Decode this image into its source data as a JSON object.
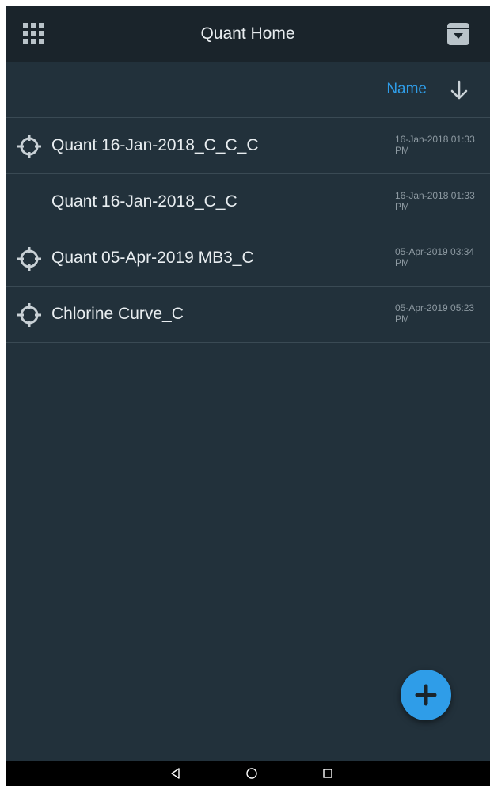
{
  "app": {
    "title": "Quant Home"
  },
  "header": {
    "left_icon": "apps-grid-icon",
    "right_icon": "archive-download-icon"
  },
  "sort": {
    "label": "Name",
    "direction_icon": "arrow-down-icon"
  },
  "items": [
    {
      "name": "Quant 16-Jan-2018_C_C_C",
      "date_line1": "16-Jan-2018 01:33",
      "date_line2": "PM",
      "icon": "target-icon"
    },
    {
      "name": "Quant 16-Jan-2018_C_C",
      "date_line1": "16-Jan-2018 01:33",
      "date_line2": "PM",
      "icon": ""
    },
    {
      "name": "Quant 05-Apr-2019 MB3_C",
      "date_line1": "05-Apr-2019 03:34",
      "date_line2": "PM",
      "icon": "target-icon"
    },
    {
      "name": "Chlorine Curve_C",
      "date_line1": "05-Apr-2019 05:23",
      "date_line2": "PM",
      "icon": "target-icon"
    }
  ],
  "fab": {
    "icon": "plus-icon"
  },
  "system_nav": {
    "back_icon": "back-triangle-icon",
    "home_icon": "home-circle-icon",
    "recents_icon": "recents-square-icon"
  },
  "colors": {
    "background": "#22313b",
    "appbar": "#1a242b",
    "accent": "#2f9de8",
    "text": "#e8edf0",
    "secondary_text": "#8e9aa2"
  }
}
